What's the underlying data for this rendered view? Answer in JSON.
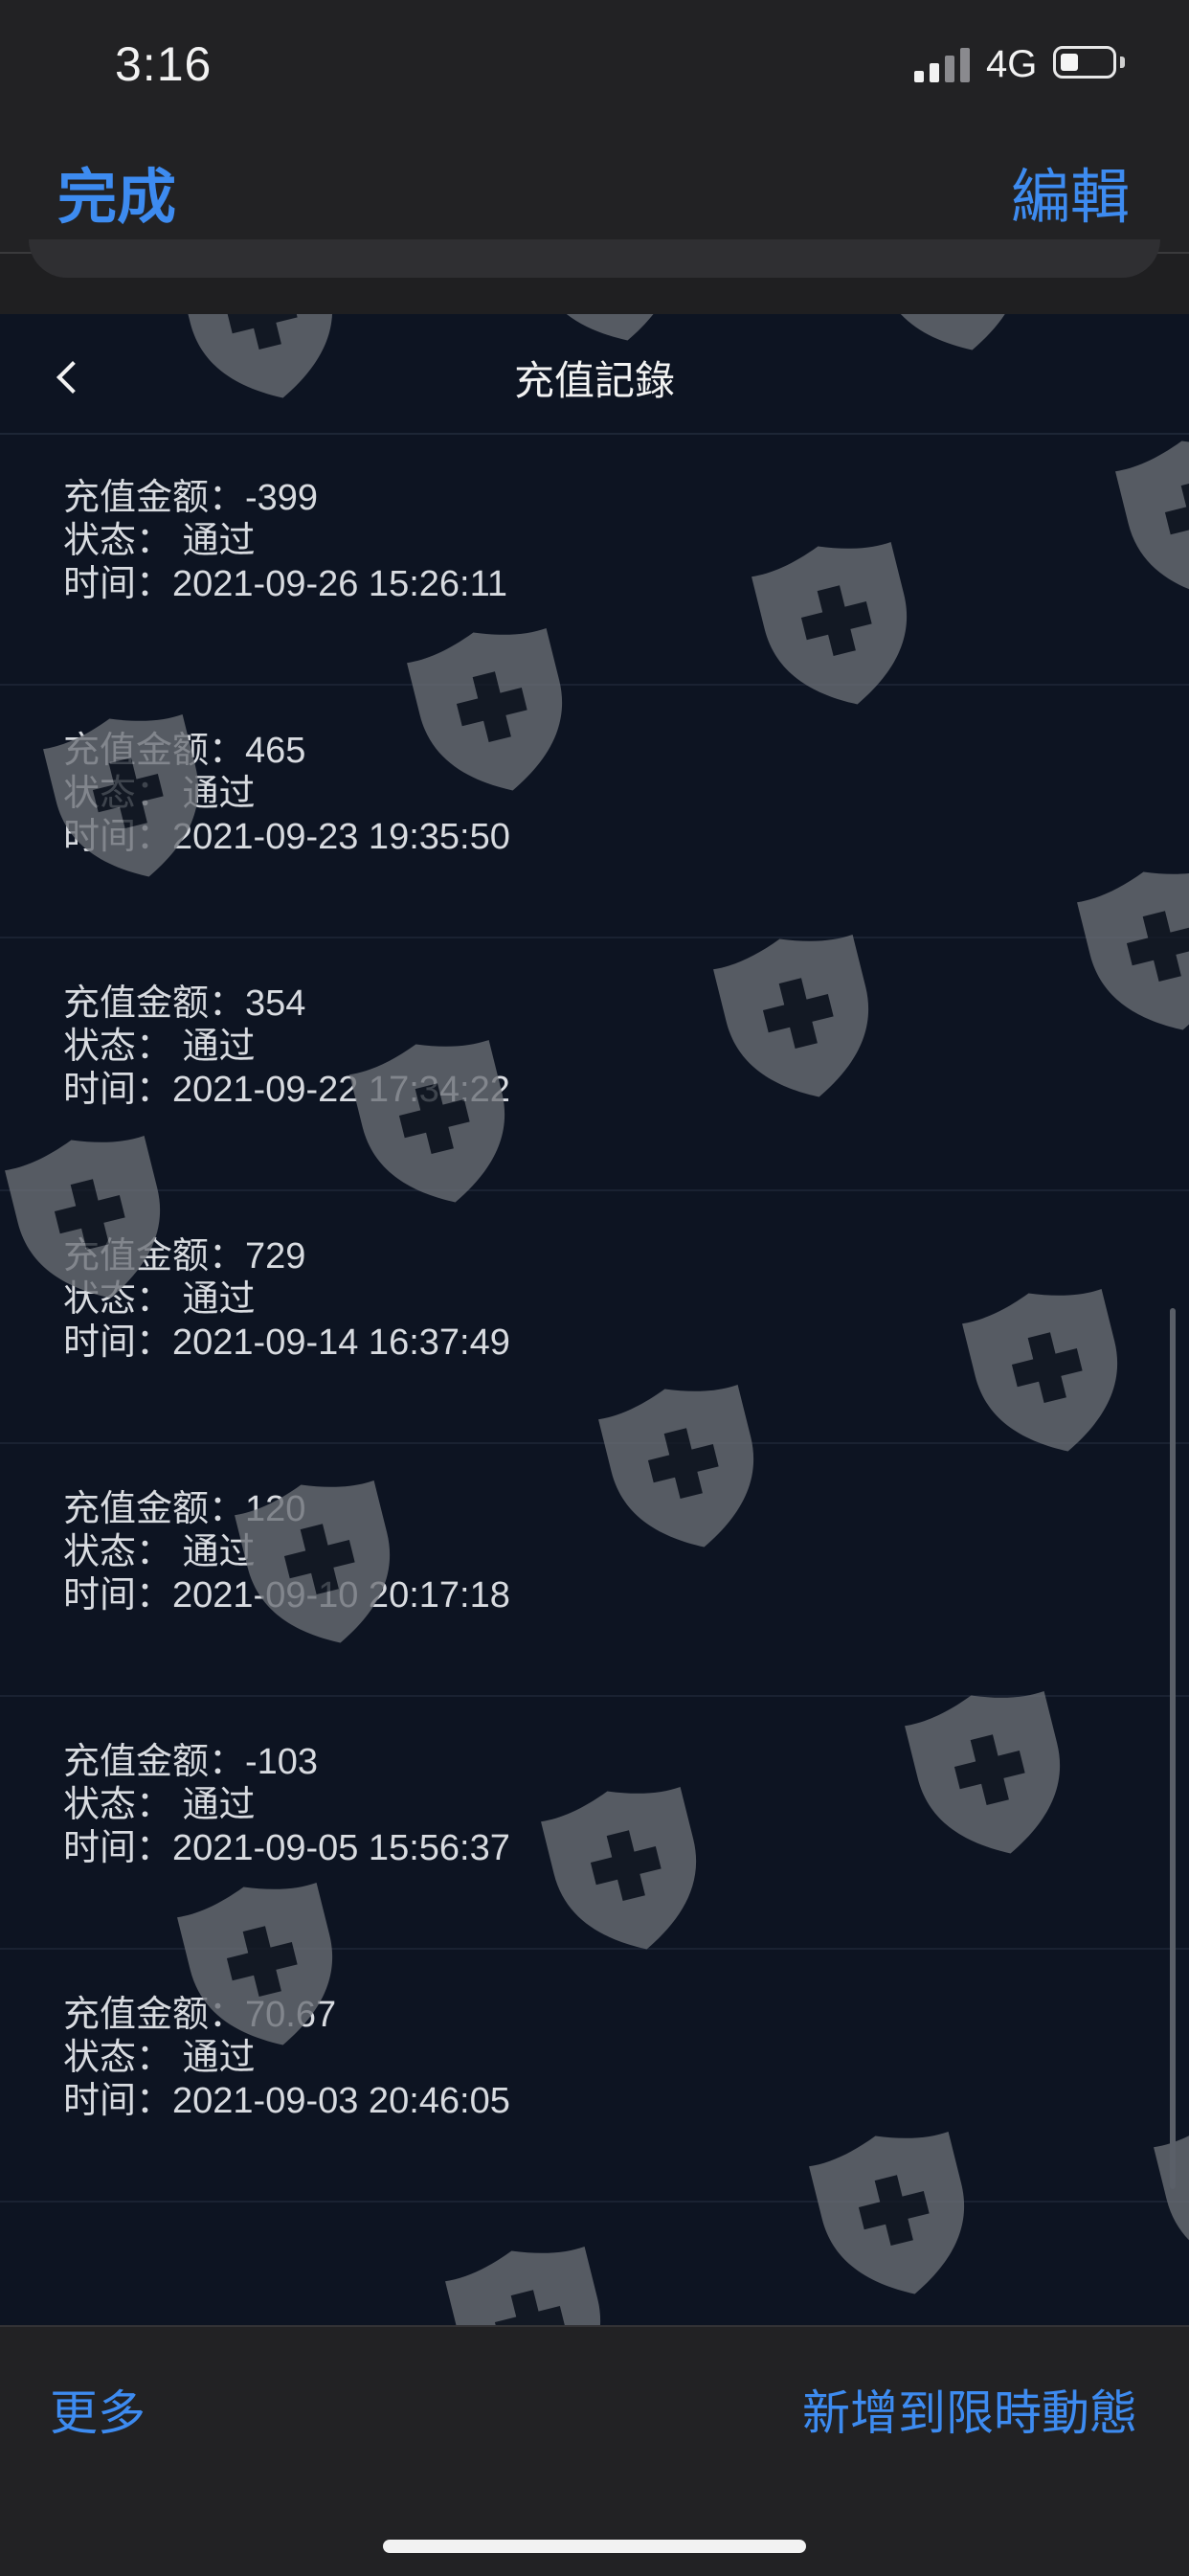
{
  "status_bar": {
    "time": "3:16",
    "network": "4G",
    "battery_icon": "battery-icon",
    "signal_icon": "signal-icon"
  },
  "nav": {
    "done_label": "完成",
    "edit_label": "編輯"
  },
  "page": {
    "title": "充值記錄",
    "back_icon": "chevron-left-icon"
  },
  "records": [
    {
      "amount": "充值金额：-399",
      "status": "状态： 通过",
      "time": "时间：2021-09-26 15:26:11"
    },
    {
      "amount": "充值金额：465",
      "status": "状态： 通过",
      "time": "时间：2021-09-23 19:35:50"
    },
    {
      "amount": "充值金额：354",
      "status": "状态： 通过",
      "time": "时间：2021-09-22 17:34:22"
    },
    {
      "amount": "充值金额：729",
      "status": "状态： 通过",
      "time": "时间：2021-09-14 16:37:49"
    },
    {
      "amount": "充值金额：120",
      "status": "状态： 通过",
      "time": "时间：2021-09-10 20:17:18"
    },
    {
      "amount": "充值金额：-103",
      "status": "状态： 通过",
      "time": "时间：2021-09-05 15:56:37"
    },
    {
      "amount": "充值金额：70.67",
      "status": "状态： 通过",
      "time": "时间：2021-09-03 20:46:05"
    }
  ],
  "bottom_bar": {
    "more_label": "更多",
    "story_label": "新增到限時動態"
  },
  "colors": {
    "accent": "#3d8bf0",
    "content_bg": "#0d1422",
    "bar_bg": "#222224",
    "watermark": "#6b6f76"
  },
  "watermark_icon": "shield-cross-icon"
}
